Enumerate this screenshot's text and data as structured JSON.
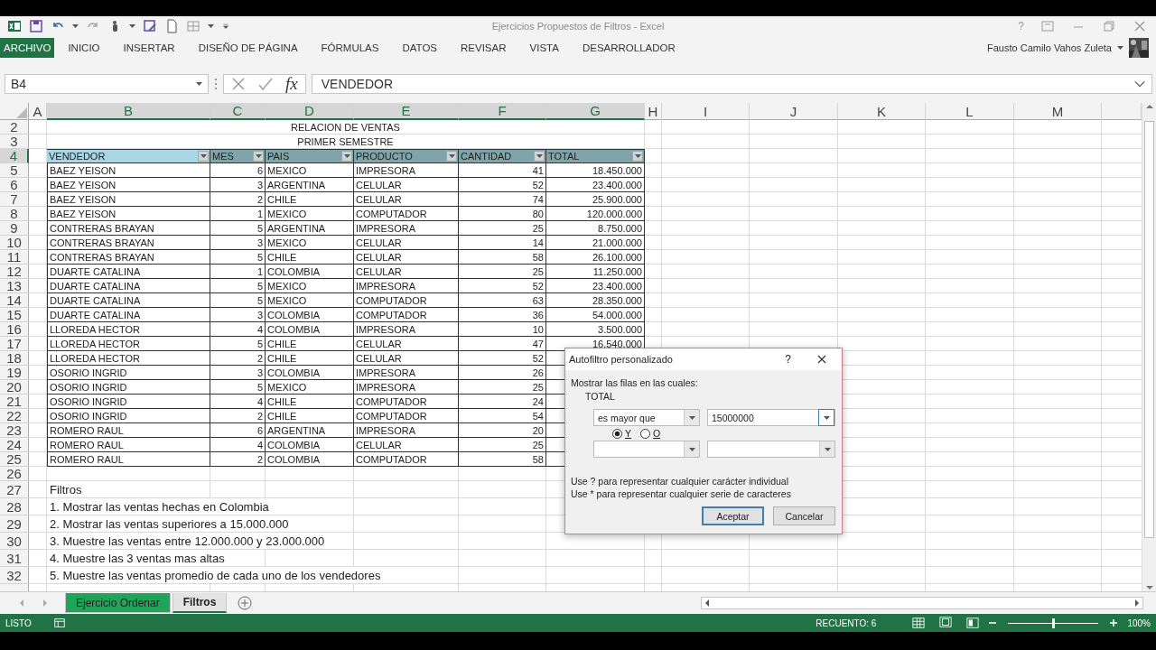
{
  "window": {
    "title": "Ejercicios Propuestos de Filtros - Excel",
    "help": "?"
  },
  "ribbon": {
    "tabs": [
      {
        "label": "ARCHIVO",
        "kind": "file",
        "selected": false
      },
      {
        "label": "INICIO",
        "kind": "tab",
        "selected": false
      },
      {
        "label": "INSERTAR",
        "kind": "tab",
        "selected": false
      },
      {
        "label": "DISEÑO DE PÁGINA",
        "kind": "tab",
        "selected": false
      },
      {
        "label": "FÓRMULAS",
        "kind": "tab",
        "selected": false
      },
      {
        "label": "DATOS",
        "kind": "tab",
        "selected": false
      },
      {
        "label": "REVISAR",
        "kind": "tab",
        "selected": false
      },
      {
        "label": "VISTA",
        "kind": "tab",
        "selected": false
      },
      {
        "label": "DESARROLLADOR",
        "kind": "tab",
        "selected": false
      }
    ],
    "user": "Fausto Camilo Vahos Zuleta"
  },
  "formula_bar": {
    "name_box": "B4",
    "fx": "fx",
    "value": "VENDEDOR"
  },
  "sheet": {
    "columns": [
      {
        "label": "A",
        "selected": false
      },
      {
        "label": "B",
        "selected": true
      },
      {
        "label": "C",
        "selected": true
      },
      {
        "label": "D",
        "selected": true
      },
      {
        "label": "E",
        "selected": true
      },
      {
        "label": "F",
        "selected": true
      },
      {
        "label": "G",
        "selected": true
      },
      {
        "label": "H",
        "selected": false
      },
      {
        "label": "I",
        "selected": false
      },
      {
        "label": "J",
        "selected": false
      },
      {
        "label": "K",
        "selected": false
      },
      {
        "label": "L",
        "selected": false
      },
      {
        "label": "M",
        "selected": false
      }
    ],
    "rows": [
      {
        "number": "2",
        "selected": false,
        "kind": "title",
        "text": "RELACION DE VENTAS"
      },
      {
        "number": "3",
        "selected": false,
        "kind": "title",
        "text": "PRIMER SEMESTRE"
      },
      {
        "number": "4",
        "selected": true,
        "kind": "header",
        "cells": [
          {
            "text": "VENDEDOR",
            "selected": true
          },
          {
            "text": "MES",
            "selected": false
          },
          {
            "text": "PAIS",
            "selected": false
          },
          {
            "text": "PRODUCTO",
            "selected": false
          },
          {
            "text": "CANTIDAD",
            "selected": false
          },
          {
            "text": "TOTAL",
            "selected": false
          }
        ]
      },
      {
        "number": "5",
        "selected": false,
        "kind": "data",
        "cells": [
          "BAEZ YEISON",
          "6",
          "MEXICO",
          "IMPRESORA",
          "41",
          "18.450.000"
        ]
      },
      {
        "number": "6",
        "selected": false,
        "kind": "data",
        "cells": [
          "BAEZ YEISON",
          "3",
          "ARGENTINA",
          "CELULAR",
          "52",
          "23.400.000"
        ]
      },
      {
        "number": "7",
        "selected": false,
        "kind": "data",
        "cells": [
          "BAEZ YEISON",
          "2",
          "CHILE",
          "CELULAR",
          "74",
          "25.900.000"
        ]
      },
      {
        "number": "8",
        "selected": false,
        "kind": "data",
        "cells": [
          "BAEZ YEISON",
          "1",
          "MEXICO",
          "COMPUTADOR",
          "80",
          "120.000.000"
        ]
      },
      {
        "number": "9",
        "selected": false,
        "kind": "data",
        "cells": [
          "CONTRERAS BRAYAN",
          "5",
          "ARGENTINA",
          "IMPRESORA",
          "25",
          "8.750.000"
        ]
      },
      {
        "number": "10",
        "selected": false,
        "kind": "data",
        "cells": [
          "CONTRERAS BRAYAN",
          "3",
          "MEXICO",
          "CELULAR",
          "14",
          "21.000.000"
        ]
      },
      {
        "number": "11",
        "selected": false,
        "kind": "data",
        "cells": [
          "CONTRERAS BRAYAN",
          "5",
          "CHILE",
          "CELULAR",
          "58",
          "26.100.000"
        ]
      },
      {
        "number": "12",
        "selected": false,
        "kind": "data",
        "cells": [
          "DUARTE CATALINA",
          "1",
          "COLOMBIA",
          "CELULAR",
          "25",
          "11.250.000"
        ]
      },
      {
        "number": "13",
        "selected": false,
        "kind": "data",
        "cells": [
          "DUARTE CATALINA",
          "5",
          "MEXICO",
          "IMPRESORA",
          "52",
          "23.400.000"
        ]
      },
      {
        "number": "14",
        "selected": false,
        "kind": "data",
        "cells": [
          "DUARTE CATALINA",
          "5",
          "MEXICO",
          "COMPUTADOR",
          "63",
          "28.350.000"
        ]
      },
      {
        "number": "15",
        "selected": false,
        "kind": "data",
        "cells": [
          "DUARTE CATALINA",
          "3",
          "COLOMBIA",
          "COMPUTADOR",
          "36",
          "54.000.000"
        ]
      },
      {
        "number": "16",
        "selected": false,
        "kind": "data",
        "cells": [
          "LLOREDA HECTOR",
          "4",
          "COLOMBIA",
          "IMPRESORA",
          "10",
          "3.500.000"
        ]
      },
      {
        "number": "17",
        "selected": false,
        "kind": "data",
        "cells": [
          "LLOREDA HECTOR",
          "5",
          "CHILE",
          "CELULAR",
          "47",
          "16.540.000"
        ]
      },
      {
        "number": "18",
        "selected": false,
        "kind": "data",
        "cells": [
          "LLOREDA HECTOR",
          "2",
          "CHILE",
          "CELULAR",
          "52"
        ]
      },
      {
        "number": "19",
        "selected": false,
        "kind": "data",
        "cells": [
          "OSORIO INGRID",
          "3",
          "COLOMBIA",
          "IMPRESORA",
          "26"
        ]
      },
      {
        "number": "20",
        "selected": false,
        "kind": "data",
        "cells": [
          "OSORIO INGRID",
          "5",
          "MEXICO",
          "IMPRESORA",
          "25"
        ]
      },
      {
        "number": "21",
        "selected": false,
        "kind": "data",
        "cells": [
          "OSORIO INGRID",
          "4",
          "CHILE",
          "COMPUTADOR",
          "24"
        ]
      },
      {
        "number": "22",
        "selected": false,
        "kind": "data",
        "cells": [
          "OSORIO INGRID",
          "2",
          "CHILE",
          "COMPUTADOR",
          "54"
        ]
      },
      {
        "number": "23",
        "selected": false,
        "kind": "data",
        "cells": [
          "ROMERO RAUL",
          "6",
          "ARGENTINA",
          "IMPRESORA",
          "20"
        ]
      },
      {
        "number": "24",
        "selected": false,
        "kind": "data",
        "cells": [
          "ROMERO RAUL",
          "4",
          "COLOMBIA",
          "CELULAR",
          "25"
        ]
      },
      {
        "number": "25",
        "selected": false,
        "kind": "data",
        "cells": [
          "ROMERO RAUL",
          "2",
          "COLOMBIA",
          "COMPUTADOR",
          "58"
        ]
      },
      {
        "number": "26",
        "selected": false,
        "kind": "blank"
      },
      {
        "number": "27",
        "selected": false,
        "kind": "note",
        "text": "Filtros"
      },
      {
        "number": "28",
        "selected": false,
        "kind": "note",
        "text": "1. Mostrar las ventas hechas en Colombia"
      },
      {
        "number": "29",
        "selected": false,
        "kind": "note",
        "text": "2. Mostrar las ventas superiores a 15.000.000"
      },
      {
        "number": "30",
        "selected": false,
        "kind": "note",
        "text": "3. Muestre las ventas entre 12.000.000 y 23.000.000"
      },
      {
        "number": "31",
        "selected": false,
        "kind": "note",
        "text": "4. Muestre las 3 ventas mas altas"
      },
      {
        "number": "32",
        "selected": false,
        "kind": "note",
        "text": "5. Muestre las ventas promedio de cada uno de los vendedores"
      }
    ]
  },
  "sheet_tabs": [
    {
      "label": "Ejercicio Ordenar",
      "selected": false,
      "color": "#21a35a"
    },
    {
      "label": "Filtros",
      "selected": true
    }
  ],
  "status_bar": {
    "mode": "LISTO",
    "count": "RECUENTO: 6",
    "zoom": {
      "level": 0.5,
      "reading": "100%"
    }
  },
  "dialog": {
    "title": "Autofiltro personalizado",
    "help": "?",
    "prompt": "Mostrar las filas en las cuales:",
    "field": "TOTAL",
    "criteria": [
      {
        "operator": "es mayor que",
        "value": "15000000"
      }
    ],
    "joins": [
      {
        "label": "Y",
        "selected": true
      },
      {
        "label": "O",
        "selected": false
      }
    ],
    "hints": [
      "Use ? para representar cualquier carácter individual",
      "Use * para representar cualquier serie de caracteres"
    ],
    "buttons": [
      {
        "label": "Aceptar",
        "default": true
      },
      {
        "label": "Cancelar",
        "default": false
      }
    ]
  }
}
